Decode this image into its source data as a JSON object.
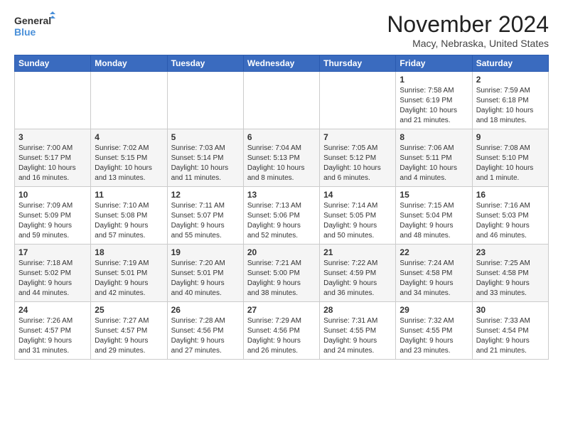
{
  "logo": {
    "line1": "General",
    "line2": "Blue"
  },
  "title": "November 2024",
  "location": "Macy, Nebraska, United States",
  "weekdays": [
    "Sunday",
    "Monday",
    "Tuesday",
    "Wednesday",
    "Thursday",
    "Friday",
    "Saturday"
  ],
  "weeks": [
    [
      {
        "day": "",
        "info": ""
      },
      {
        "day": "",
        "info": ""
      },
      {
        "day": "",
        "info": ""
      },
      {
        "day": "",
        "info": ""
      },
      {
        "day": "",
        "info": ""
      },
      {
        "day": "1",
        "info": "Sunrise: 7:58 AM\nSunset: 6:19 PM\nDaylight: 10 hours\nand 21 minutes."
      },
      {
        "day": "2",
        "info": "Sunrise: 7:59 AM\nSunset: 6:18 PM\nDaylight: 10 hours\nand 18 minutes."
      }
    ],
    [
      {
        "day": "3",
        "info": "Sunrise: 7:00 AM\nSunset: 5:17 PM\nDaylight: 10 hours\nand 16 minutes."
      },
      {
        "day": "4",
        "info": "Sunrise: 7:02 AM\nSunset: 5:15 PM\nDaylight: 10 hours\nand 13 minutes."
      },
      {
        "day": "5",
        "info": "Sunrise: 7:03 AM\nSunset: 5:14 PM\nDaylight: 10 hours\nand 11 minutes."
      },
      {
        "day": "6",
        "info": "Sunrise: 7:04 AM\nSunset: 5:13 PM\nDaylight: 10 hours\nand 8 minutes."
      },
      {
        "day": "7",
        "info": "Sunrise: 7:05 AM\nSunset: 5:12 PM\nDaylight: 10 hours\nand 6 minutes."
      },
      {
        "day": "8",
        "info": "Sunrise: 7:06 AM\nSunset: 5:11 PM\nDaylight: 10 hours\nand 4 minutes."
      },
      {
        "day": "9",
        "info": "Sunrise: 7:08 AM\nSunset: 5:10 PM\nDaylight: 10 hours\nand 1 minute."
      }
    ],
    [
      {
        "day": "10",
        "info": "Sunrise: 7:09 AM\nSunset: 5:09 PM\nDaylight: 9 hours\nand 59 minutes."
      },
      {
        "day": "11",
        "info": "Sunrise: 7:10 AM\nSunset: 5:08 PM\nDaylight: 9 hours\nand 57 minutes."
      },
      {
        "day": "12",
        "info": "Sunrise: 7:11 AM\nSunset: 5:07 PM\nDaylight: 9 hours\nand 55 minutes."
      },
      {
        "day": "13",
        "info": "Sunrise: 7:13 AM\nSunset: 5:06 PM\nDaylight: 9 hours\nand 52 minutes."
      },
      {
        "day": "14",
        "info": "Sunrise: 7:14 AM\nSunset: 5:05 PM\nDaylight: 9 hours\nand 50 minutes."
      },
      {
        "day": "15",
        "info": "Sunrise: 7:15 AM\nSunset: 5:04 PM\nDaylight: 9 hours\nand 48 minutes."
      },
      {
        "day": "16",
        "info": "Sunrise: 7:16 AM\nSunset: 5:03 PM\nDaylight: 9 hours\nand 46 minutes."
      }
    ],
    [
      {
        "day": "17",
        "info": "Sunrise: 7:18 AM\nSunset: 5:02 PM\nDaylight: 9 hours\nand 44 minutes."
      },
      {
        "day": "18",
        "info": "Sunrise: 7:19 AM\nSunset: 5:01 PM\nDaylight: 9 hours\nand 42 minutes."
      },
      {
        "day": "19",
        "info": "Sunrise: 7:20 AM\nSunset: 5:01 PM\nDaylight: 9 hours\nand 40 minutes."
      },
      {
        "day": "20",
        "info": "Sunrise: 7:21 AM\nSunset: 5:00 PM\nDaylight: 9 hours\nand 38 minutes."
      },
      {
        "day": "21",
        "info": "Sunrise: 7:22 AM\nSunset: 4:59 PM\nDaylight: 9 hours\nand 36 minutes."
      },
      {
        "day": "22",
        "info": "Sunrise: 7:24 AM\nSunset: 4:58 PM\nDaylight: 9 hours\nand 34 minutes."
      },
      {
        "day": "23",
        "info": "Sunrise: 7:25 AM\nSunset: 4:58 PM\nDaylight: 9 hours\nand 33 minutes."
      }
    ],
    [
      {
        "day": "24",
        "info": "Sunrise: 7:26 AM\nSunset: 4:57 PM\nDaylight: 9 hours\nand 31 minutes."
      },
      {
        "day": "25",
        "info": "Sunrise: 7:27 AM\nSunset: 4:57 PM\nDaylight: 9 hours\nand 29 minutes."
      },
      {
        "day": "26",
        "info": "Sunrise: 7:28 AM\nSunset: 4:56 PM\nDaylight: 9 hours\nand 27 minutes."
      },
      {
        "day": "27",
        "info": "Sunrise: 7:29 AM\nSunset: 4:56 PM\nDaylight: 9 hours\nand 26 minutes."
      },
      {
        "day": "28",
        "info": "Sunrise: 7:31 AM\nSunset: 4:55 PM\nDaylight: 9 hours\nand 24 minutes."
      },
      {
        "day": "29",
        "info": "Sunrise: 7:32 AM\nSunset: 4:55 PM\nDaylight: 9 hours\nand 23 minutes."
      },
      {
        "day": "30",
        "info": "Sunrise: 7:33 AM\nSunset: 4:54 PM\nDaylight: 9 hours\nand 21 minutes."
      }
    ]
  ]
}
